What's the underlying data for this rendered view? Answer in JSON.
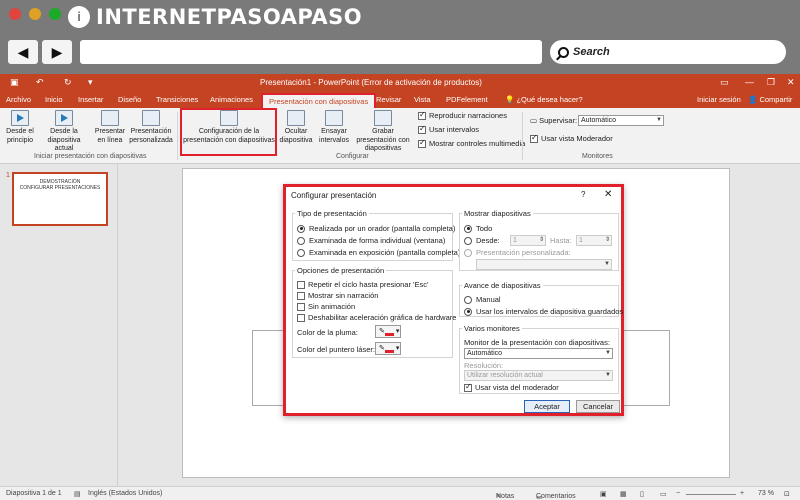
{
  "browser": {
    "logo_text": "INTERNETPASOAPASO",
    "logo_initial": "i",
    "back_label": "◀",
    "forward_label": "▶",
    "search_label": "Search",
    "colors": {
      "close": "#e0443e",
      "minimize": "#dea123",
      "maximize": "#1aab29"
    }
  },
  "app": {
    "title": "Presentación1 - PowerPoint (Error de activación de productos)",
    "user": "Iniciar sesión",
    "share": "Compartir",
    "tell_me": "¿Qué desea hacer?",
    "accent": "#c44323"
  },
  "tabs": [
    "Archivo",
    "Inicio",
    "Insertar",
    "Diseño",
    "Transiciones",
    "Animaciones",
    "Presentación con diapositivas",
    "Revisar",
    "Vista",
    "PDFelement"
  ],
  "ribbon": {
    "from_start": "Desde el principio",
    "from_current": "Desde la diapositiva actual",
    "present_online": "Presentar en línea",
    "custom_show": "Presentación personalizada",
    "group_start": "Iniciar presentación con diapositivas",
    "setup": "Configuración de la presentación con diapositivas",
    "hide_slide": "Ocultar diapositiva",
    "rehearse": "Ensayar intervalos",
    "record": "Grabar presentación con diapositivas",
    "play_narrations": "Reproducir narraciones",
    "use_timings": "Usar intervalos",
    "show_media": "Mostrar controles multimedia",
    "group_config": "Configurar",
    "monitor_label": "Supervisar:",
    "monitor_value": "Automático",
    "presenter_view": "Usar vista Moderador",
    "group_monitors": "Monitores"
  },
  "thumbnail": {
    "number": "1",
    "line1": "DEMOSTRACIÓN",
    "line2": "CONFIGURAR PRESENTACIONES"
  },
  "dialog": {
    "title": "Configurar presentación",
    "help": "?",
    "close": "✕",
    "type_group": "Tipo de presentación",
    "type_options": [
      "Realizada por un orador (pantalla completa)",
      "Examinada de forma individual (ventana)",
      "Examinada en exposición (pantalla completa)"
    ],
    "options_group": "Opciones de presentación",
    "options": [
      "Repetir el ciclo hasta presionar 'Esc'",
      "Mostrar sin narración",
      "Sin animación",
      "Deshabilitar aceleración gráfica de hardware"
    ],
    "pen_color": "Color de la pluma:",
    "laser_color": "Color del puntero láser:",
    "show_group": "Mostrar diapositivas",
    "all": "Todo",
    "from": "Desde:",
    "from_value": "1",
    "to": "Hasta:",
    "to_value": "1",
    "custom": "Presentación personalizada:",
    "advance_group": "Avance de diapositivas",
    "manual": "Manual",
    "use_saved": "Usar los intervalos de diapositiva guardados",
    "monitors_group": "Varios monitores",
    "monitor_label": "Monitor de la presentación con diapositivas:",
    "monitor_value": "Automático",
    "resolution_label": "Resolución:",
    "resolution_value": "Utilizar resolución actual",
    "presenter_view": "Usar vista del moderador",
    "accept": "Aceptar",
    "cancel": "Cancelar"
  },
  "status": {
    "slide": "Diapositiva 1 de 1",
    "lang": "Inglés (Estados Unidos)",
    "notes": "Notas",
    "comments": "Comentarios",
    "zoom": "73 %"
  }
}
